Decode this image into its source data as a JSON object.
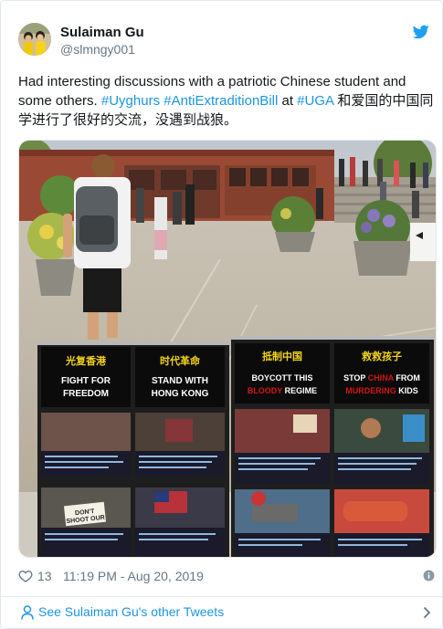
{
  "author": {
    "display_name": "Sulaiman Gu",
    "handle": "@slmngy001"
  },
  "tweet": {
    "text_pre": "Had interesting discussions with a patriotic Chinese student and some others. ",
    "hashtag_1": "#Uyghurs",
    "hashtag_2": "#AntiExtraditionBill",
    "text_at": " at ",
    "hashtag_3": "#UGA",
    "text_post": " 和爱国的中国同学进行了很好的交流，没遇到战狼。"
  },
  "photo_posters": {
    "left_headers": [
      "光复香港",
      "时代革命"
    ],
    "left_sub": [
      "FIGHT FOR FREEDOM",
      "STAND WITH HONG KONG"
    ],
    "right_headers": [
      "抵制中国",
      "救救孩子"
    ],
    "right_sub_1a": "BOYCOTT THIS",
    "right_sub_1b": "BLOODY",
    "right_sub_1c": " REGIME",
    "right_sub_2a": "STOP ",
    "right_sub_2b": "CHINA",
    "right_sub_2c": " FROM",
    "right_sub_2d": "MURDERING",
    "right_sub_2e": " KIDS",
    "sign_text": "DON'T SHOOT OUR KIDS!",
    "caption_1": "Hong Kong's youth say no to a bill that will allow the city's puppet government to extradite dissidents to China.",
    "caption_2": "Police fire tear gas indiscriminately at a railway station and a protester displays his injury caused by knife-wielding thugs.",
    "caption_3": "Hong Kong parents sit in front of young protesters begging for the city's abusive",
    "caption_4": "Armed with helmets, umbrellas, masks and American flags, students rise for a",
    "caption_5": "The Hong Kong girl lost half of her vision when a ... bullet shot her in the right eye during a recent protest.",
    "caption_6": "This Uyghur boy lost his life when he was held in a ... for attempting to flee to Turkey where he was a citizen.",
    "caption_7": "... in Hong Kong and East Turkestan call them and other brave kids",
    "caption_8": "They are subjected to ... in their occupied lands"
  },
  "footer": {
    "like_count": "13",
    "timestamp": "11:19 PM - Aug 20, 2019"
  },
  "more_tweets_label": "See Sulaiman Gu's other Tweets",
  "colors": {
    "link": "#1b95e0",
    "text": "#14171a",
    "muted": "#657786",
    "poster_yellow": "#f2d21a",
    "poster_red": "#d41414"
  }
}
